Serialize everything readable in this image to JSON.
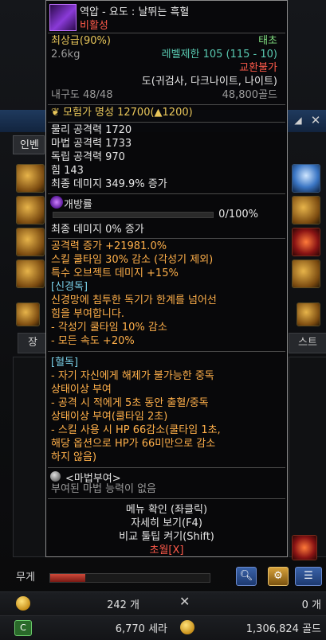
{
  "item": {
    "name": "역압 - 요도 : 날뛰는 흑혈",
    "tag": "비활성",
    "grade": "최상급(90%)",
    "rarity": "태초",
    "weight": "2.6kg",
    "level_limit": "레벨제한 105 (115 - 10)",
    "trade": "교환불가",
    "classes": "도(귀검사, 다크나이트, 나이트)",
    "durability": "내구도 48/48",
    "price": "48,800골드",
    "adventure_fame": "모험가 명성 12700(▲1200)",
    "stats": [
      "물리 공격력 1720",
      "마법 공격력 1733",
      "독립 공격력 970",
      "힘 143",
      "최종 데미지 349.9% 증가"
    ],
    "open_label": "개방률",
    "progress_text": "0/100%",
    "progress": 0,
    "final_damage": "최종 데미지 0% 증가",
    "options": [
      "공격력 증가 +21981.0%",
      "스킬 쿨타임 30% 감소 (각성기 제외)",
      "특수 오브젝트 데미지 +15%"
    ],
    "neuro_title": "[신경독]",
    "neuro_lines": [
      "신경망에 침투한 독기가 한계를 넘어선",
      "힘을 부여합니다.",
      "- 각성기 쿨타임 10% 감소",
      "- 모든 속도 +20%"
    ],
    "blood_title": "[혈독]",
    "blood_lines": [
      "- 자기 자신에게 해제가 불가능한 중독",
      "상태이상 부여",
      "- 공격 시 적에게 5초 동안 출혈/중독",
      "상태이상 부여(쿨타임 2초)",
      "- 스킬 사용 시 HP 66감소(쿨타임 1초,",
      "해당 옵션으로 HP가 66미만으로 감소",
      "하지 않음)"
    ],
    "magic_title": "<마법부여>",
    "magic_text": "부여된 마법 능력이 없음",
    "menu": [
      "메뉴 확인 (좌클릭)",
      "자세히 보기(F4)",
      "비교 툴팁 켜기(Shift)"
    ],
    "close_label": "초월[X]"
  },
  "background": {
    "tab_inven": "인벤",
    "tab_jang": "장",
    "tab_right": "스트",
    "weight_label": "무게"
  },
  "bottom": {
    "count_left": "242 개",
    "count_right": "0 개",
    "cera": "6,770 세라",
    "gold": "1,306,824 골드"
  }
}
